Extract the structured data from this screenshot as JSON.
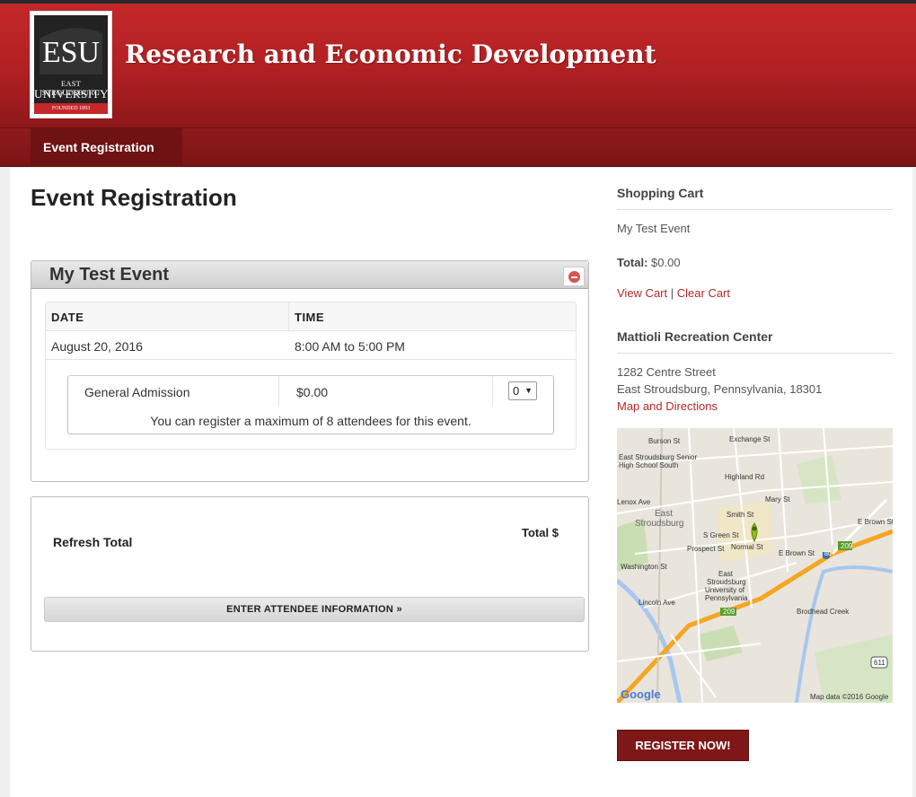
{
  "header": {
    "site_title": "Research and Economic Development",
    "logo": {
      "line1": "EAST STROUDSBURG",
      "line2": "UNIVERSITY",
      "founded": "FOUNDED 1893"
    }
  },
  "nav": {
    "items": [
      {
        "label": "Event Registration"
      }
    ]
  },
  "main": {
    "page_title": "Event Registration",
    "event": {
      "title": "My Test Event",
      "columns": [
        "DATE",
        "TIME"
      ],
      "date": "August 20, 2016",
      "time": "8:00 AM to 5:00 PM",
      "ticket": {
        "name": "General Admission",
        "price": "$0.00",
        "quantity": "0",
        "note": "You can register a maximum of 8 attendees for this event."
      }
    },
    "totals": {
      "refresh_label": "Refresh Total",
      "total_label": "Total $",
      "attendee_button": "ENTER ATTENDEE INFORMATION »"
    }
  },
  "sidebar": {
    "cart": {
      "heading": "Shopping Cart",
      "item": "My Test Event",
      "total_label": "Total:",
      "total_value": "$0.00",
      "view_cart": "View Cart",
      "separator": "|",
      "clear_cart": "Clear Cart"
    },
    "venue": {
      "heading": "Mattioli Recreation Center",
      "street": "1282 Centre Street",
      "city": "East Stroudsburg, Pennsylvania, 18301",
      "directions": "Map and Directions"
    },
    "map": {
      "labels": {
        "burson": "Burson St",
        "exchange": "Exchange St",
        "school": "East Stroudsburg Senior",
        "school2": "High School South",
        "highland": "Highland Rd",
        "mary": "Mary St",
        "lenox": "Lenox Ave",
        "town1": "East",
        "town2": "Stroudsburg",
        "smith": "Smith St",
        "ebrown": "E Brown St",
        "ebrown2": "E Brown St",
        "green": "S Green St",
        "normal": "Normal St",
        "prospect": "Prospect St",
        "washington": "Washington St",
        "univ1": "East",
        "univ2": "Stroudsburg",
        "univ3": "University of",
        "univ4": "Pennsylvania",
        "lincoln": "Lincoln Ave",
        "brodhead": "Brodhead Creek",
        "r209": "209",
        "r80": "80",
        "r611": "611",
        "google": "Google",
        "attribution": "Map data ©2016 Google"
      }
    },
    "register_button": "REGISTER NOW!"
  },
  "colors": {
    "header_red": "#c4282a",
    "nav_dark": "#7b1416",
    "link_red": "#b22a27",
    "button_red": "#7e1718"
  }
}
